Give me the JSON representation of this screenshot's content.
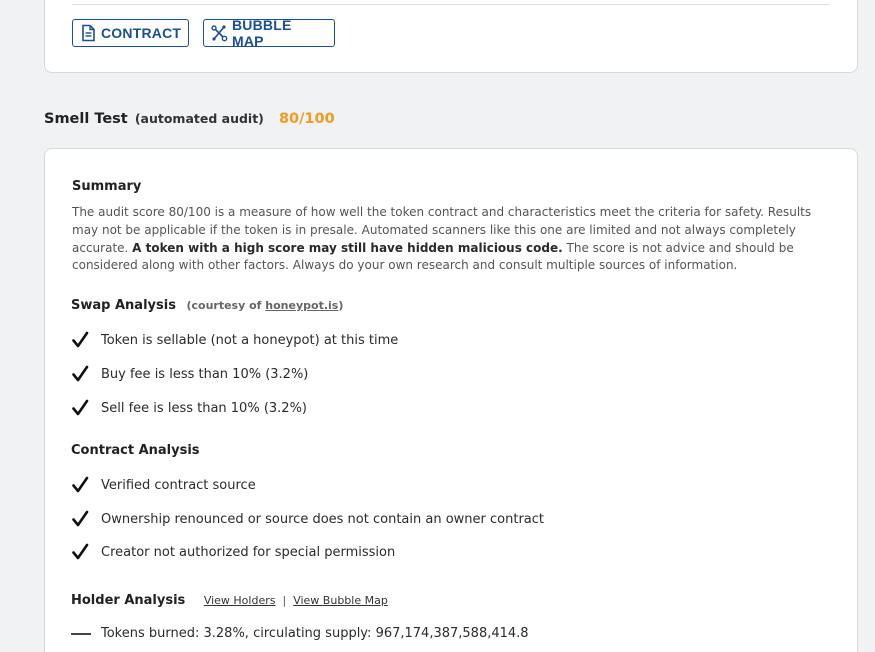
{
  "toolbar": {
    "contract_label": "CONTRACT",
    "bubble_map_label": "BUBBLE MAP"
  },
  "smell_test": {
    "title": "Smell Test",
    "subtitle": "(automated audit)",
    "score": "80/100"
  },
  "summary": {
    "title": "Summary",
    "text_part1": "The audit score 80/100 is a measure of how well the token contract and characteristics meet the criteria for safety.  Results may not be applicable if the token is in presale.  Automated scanners like this one are limited and not always completely accurate.  ",
    "text_bold": "A token with a high score may still have hidden malicious code.",
    "text_part2": " The score is not advice and should be considered along with other factors. Always do your own research and consult multiple sources of information."
  },
  "swap_analysis": {
    "title": "Swap Analysis",
    "courtesy_prefix": "(courtesy of ",
    "courtesy_link": "honeypot.is",
    "courtesy_suffix": ")",
    "items": [
      "Token is sellable (not a honeypot) at this time",
      "Buy fee is less than 10% (3.2%)",
      "Sell fee is less than 10% (3.2%)"
    ]
  },
  "contract_analysis": {
    "title": "Contract Analysis",
    "items": [
      "Verified contract source",
      "Ownership renounced or source does not contain an owner contract",
      "Creator not authorized for special permission"
    ]
  },
  "holder_analysis": {
    "title": "Holder Analysis",
    "view_holders": "View Holders",
    "separator": "|",
    "view_bubble_map": "View Bubble Map",
    "items": [
      "Tokens burned: 3.28%, circulating supply: 967,174,387,588,414.8"
    ]
  },
  "colors": {
    "accent_blue": "#1c4f8f",
    "score_orange": "#f29b21",
    "page_bg": "#f1f2f3"
  },
  "icons": {
    "contract": "document-icon",
    "bubble_map": "bubble-map-icon",
    "check": "check-icon"
  }
}
